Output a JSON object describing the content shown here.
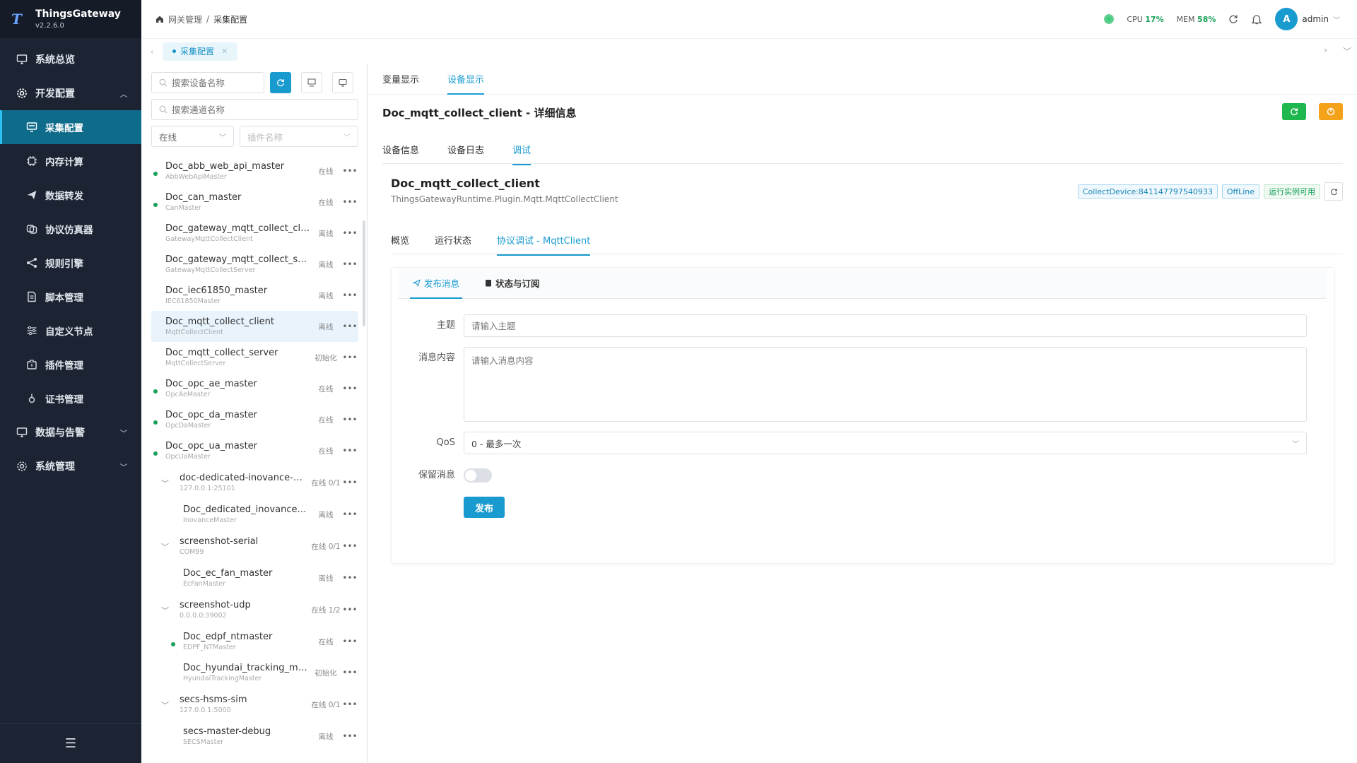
{
  "app": {
    "name": "ThingsGateway",
    "version": "v2.2.6.0"
  },
  "sidebar": {
    "items": [
      {
        "label": "系统总览",
        "icon": "monitor-icon"
      },
      {
        "label": "开发配置",
        "icon": "gear-icon"
      },
      {
        "label": "采集配置",
        "icon": "collect-icon"
      },
      {
        "label": "内存计算",
        "icon": "chip-icon"
      },
      {
        "label": "数据转发",
        "icon": "send-icon"
      },
      {
        "label": "协议仿真器",
        "icon": "layers-icon"
      },
      {
        "label": "规则引擎",
        "icon": "share-icon"
      },
      {
        "label": "脚本管理",
        "icon": "file-icon"
      },
      {
        "label": "自定义节点",
        "icon": "sliders-icon"
      },
      {
        "label": "插件管理",
        "icon": "plugin-icon"
      },
      {
        "label": "证书管理",
        "icon": "certificate-icon"
      },
      {
        "label": "数据与告警",
        "icon": "monitor-icon"
      },
      {
        "label": "系统管理",
        "icon": "gear-icon"
      }
    ]
  },
  "header": {
    "breadcrumb": [
      "网关管理",
      "采集配置"
    ],
    "cpu_label": "CPU",
    "cpu_value": "17%",
    "mem_label": "MEM",
    "mem_value": "58%",
    "user": "admin",
    "avatar_letter": "A"
  },
  "tabstrip": {
    "active_tab": "采集配置"
  },
  "devpanel": {
    "search_device_placeholder": "搜索设备名称",
    "search_channel_placeholder": "搜索通道名称",
    "status_filter": "在线",
    "plugin_placeholder": "插件名称",
    "devices": [
      {
        "name": "Doc_abb_web_api_master",
        "plugin": "AbbWebApiMaster",
        "status": "在线"
      },
      {
        "name": "Doc_can_master",
        "plugin": "CanMaster",
        "status": "在线"
      },
      {
        "name": "Doc_gateway_mqtt_collect_client",
        "plugin": "GatewayMqttCollectClient",
        "status": "离线"
      },
      {
        "name": "Doc_gateway_mqtt_collect_server",
        "plugin": "GatewayMqttCollectServer",
        "status": "离线"
      },
      {
        "name": "Doc_iec61850_master",
        "plugin": "IEC61850Master",
        "status": "离线"
      },
      {
        "name": "Doc_mqtt_collect_client",
        "plugin": "MqttCollectClient",
        "status": "离线"
      },
      {
        "name": "Doc_mqtt_collect_server",
        "plugin": "MqttCollectServer",
        "status": "初始化"
      },
      {
        "name": "Doc_opc_ae_master",
        "plugin": "OpcAeMaster",
        "status": "在线"
      },
      {
        "name": "Doc_opc_da_master",
        "plugin": "OpcDaMaster",
        "status": "在线"
      },
      {
        "name": "Doc_opc_ua_master",
        "plugin": "OpcUaMaster",
        "status": "在线"
      },
      {
        "name": "doc-dedicated-inovance-m...",
        "plugin": "127.0.0.1:25101",
        "status": "在线 0/1"
      },
      {
        "name": "Doc_dedicated_inovance_ma...",
        "plugin": "InovanceMaster",
        "status": "离线"
      },
      {
        "name": "screenshot-serial",
        "plugin": "COM99",
        "status": "在线 0/1"
      },
      {
        "name": "Doc_ec_fan_master",
        "plugin": "EcFanMaster",
        "status": "离线"
      },
      {
        "name": "screenshot-udp",
        "plugin": "0.0.0.0:39002",
        "status": "在线 1/2"
      },
      {
        "name": "Doc_edpf_ntmaster",
        "plugin": "EDPF_NTMaster",
        "status": "在线"
      },
      {
        "name": "Doc_hyundai_tracking_mas...",
        "plugin": "HyundaiTrackingMaster",
        "status": "初始化"
      },
      {
        "name": "secs-hsms-sim",
        "plugin": "127.0.0.1:5000",
        "status": "在线 0/1"
      },
      {
        "name": "secs-master-debug",
        "plugin": "SECSMaster",
        "status": "离线"
      }
    ]
  },
  "main": {
    "view_tabs": [
      "变量显示",
      "设备显示"
    ],
    "detail_title": "Doc_mqtt_collect_client - 详细信息",
    "detail_tabs": [
      "设备信息",
      "设备日志",
      "调试"
    ],
    "device_title": "Doc_mqtt_collect_client",
    "device_plugin_path": "ThingsGatewayRuntime.Plugin.Mqtt.MqttCollectClient",
    "badge_device": "CollectDevice:841147797540933",
    "badge_status": "OffLine",
    "badge_runtime": "运行实例可用",
    "plugin_tabs": [
      "概览",
      "运行状态",
      "协议调试 - MqttClient"
    ],
    "sub_tabs": [
      "发布消息",
      "状态与订阅"
    ],
    "form": {
      "topic_label": "主题",
      "topic_placeholder": "请输入主题",
      "payload_label": "消息内容",
      "payload_placeholder": "请输入消息内容",
      "qos_label": "QoS",
      "qos_value": "0 - 最多一次",
      "retain_label": "保留消息",
      "publish_label": "发布"
    }
  },
  "colors": {
    "accent": "#1a9bd0",
    "sidebar_bg": "#1c2433",
    "online": "#18a058"
  }
}
